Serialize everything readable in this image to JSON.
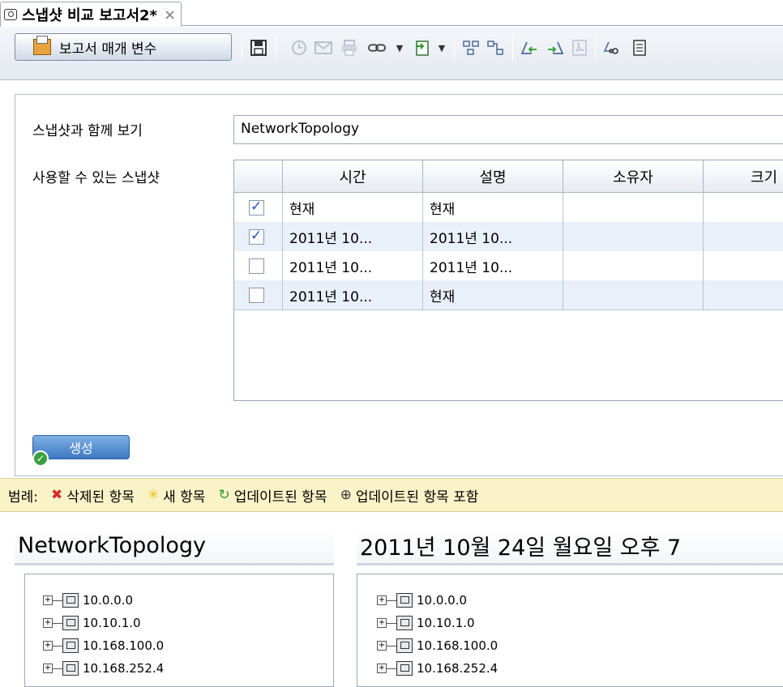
{
  "tab": {
    "title": "스냅샷 비교 보고서2*",
    "close": "×",
    "icon": "camera-icon"
  },
  "toolbar": {
    "params_label": "보고서 매개 변수",
    "icons": [
      "save-icon",
      "schedule-icon",
      "email-icon",
      "print-icon",
      "link-icon",
      "dropdown-icon",
      "export-icon",
      "dropdown-icon",
      "expand-all-icon",
      "collapse-all-icon",
      "prev-change-icon",
      "next-change-icon",
      "pdf-icon",
      "find-icon",
      "more-icon"
    ]
  },
  "params": {
    "with_snapshot_label": "스냅샷과 함께 보기",
    "with_snapshot_value": "NetworkTopology",
    "available_label": "사용할 수 있는 스냅샷",
    "columns": [
      "시간",
      "설명",
      "소유자",
      "크기"
    ],
    "rows": [
      {
        "checked": true,
        "time": "현재",
        "desc": "현재",
        "owner": "",
        "size": ""
      },
      {
        "checked": true,
        "time": "2011년 10...",
        "desc": "2011년 10...",
        "owner": "",
        "size": ""
      },
      {
        "checked": false,
        "time": "2011년 10...",
        "desc": "2011년 10...",
        "owner": "",
        "size": ""
      },
      {
        "checked": false,
        "time": "2011년 10...",
        "desc": "현재",
        "owner": "",
        "size": ""
      }
    ],
    "create_label": "생성"
  },
  "legend": {
    "label": "범례:",
    "deleted_marker": "✖",
    "deleted": "삭제된 항목",
    "new_marker": "✳",
    "new": "새 항목",
    "updated_marker": "↻",
    "updated": "업데이트된 항목",
    "contains_marker": "⊕",
    "contains": "업데이트된 항목 포함"
  },
  "left_pane": {
    "title": "NetworkTopology",
    "nodes": [
      "10.0.0.0",
      "10.10.1.0",
      "10.168.100.0",
      "10.168.252.4"
    ]
  },
  "right_pane": {
    "title": "2011년 10월 24일 월요일 오후 7",
    "nodes": [
      "10.0.0.0",
      "10.10.1.0",
      "10.168.100.0",
      "10.168.252.4"
    ]
  },
  "colors": {
    "legend_bg": "#fbf3c8",
    "deleted": "#d82a2a",
    "new": "#f0b81e",
    "updated": "#2e9b2e",
    "row_alt": "#e9f0fa"
  }
}
